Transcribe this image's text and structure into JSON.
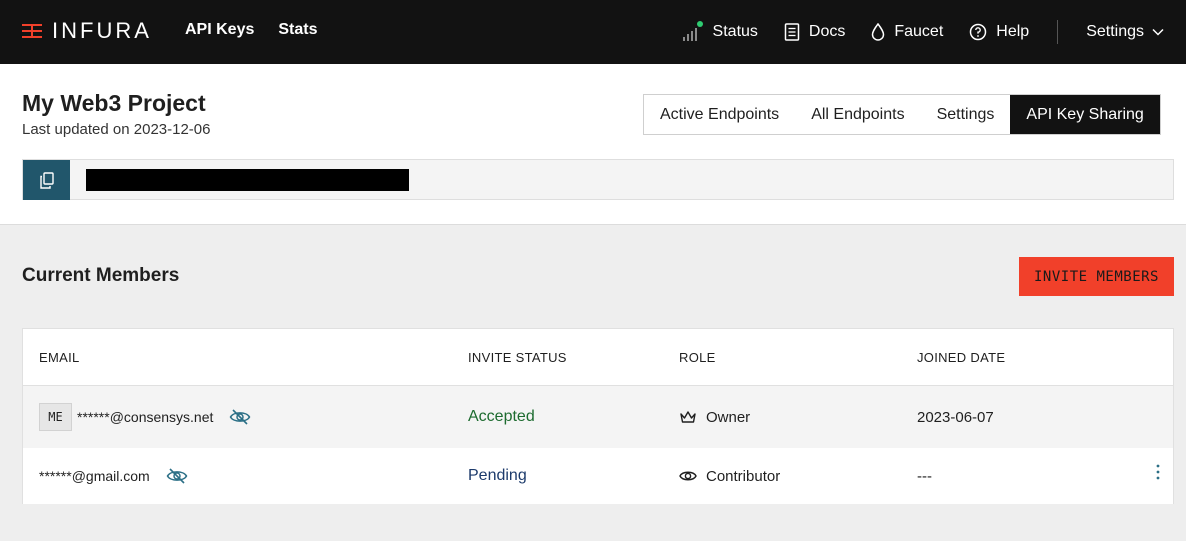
{
  "nav": {
    "brand": "INFURA",
    "links": [
      "API Keys",
      "Stats"
    ],
    "status_label": "Status",
    "docs_label": "Docs",
    "faucet_label": "Faucet",
    "help_label": "Help",
    "settings_label": "Settings"
  },
  "project": {
    "title": "My Web3 Project",
    "updated": "Last updated on 2023-12-06",
    "tabs": [
      "Active Endpoints",
      "All Endpoints",
      "Settings",
      "API Key Sharing"
    ],
    "active_tab": "API Key Sharing"
  },
  "members": {
    "title": "Current Members",
    "invite_label": "INVITE MEMBERS",
    "columns": [
      "EMAIL",
      "INVITE STATUS",
      "ROLE",
      "JOINED DATE"
    ],
    "rows": [
      {
        "badge": "ME",
        "email": "******@consensys.net",
        "status": "Accepted",
        "role": "Owner",
        "joined": "2023-06-07"
      },
      {
        "badge": "",
        "email": "******@gmail.com",
        "status": "Pending",
        "role": "Contributor",
        "joined": "---"
      }
    ]
  },
  "colors": {
    "topbar": "#121212",
    "accent_red": "#f1402a",
    "copy_button": "#21566b",
    "accepted": "#1d6b2f",
    "pending": "#1c3a6b",
    "status_dot": "#2ecc71"
  }
}
